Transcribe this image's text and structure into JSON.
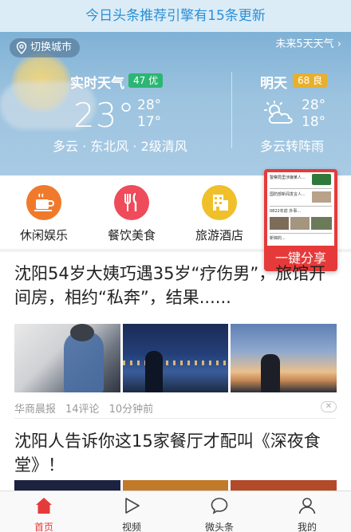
{
  "banner": {
    "text": "今日头条推荐引擎有15条更新"
  },
  "weather": {
    "city_button": "切换城市",
    "forecast_link": "未来5天天气 ›",
    "today": {
      "label": "实时天气",
      "aqi": "47 优",
      "temp": "23°",
      "high": "28°",
      "low": "17°",
      "desc": "多云 · 东北风 · 2级清风"
    },
    "tomorrow": {
      "label": "明天",
      "aqi": "68 良",
      "high": "28°",
      "low": "18°",
      "desc": "多云转阵雨"
    }
  },
  "categories": [
    {
      "label": "休闲娱乐",
      "icon": "coffee-icon",
      "color": "#f07a2b"
    },
    {
      "label": "餐饮美食",
      "icon": "dining-icon",
      "color": "#ee4b5b"
    },
    {
      "label": "旅游酒店",
      "icon": "hotel-icon",
      "color": "#f0c02a"
    }
  ],
  "share_popup": {
    "label": "一键分享",
    "preview_lines": [
      "警察局里涉嫌某人...",
      "国防部新闻发言人...",
      "0822年前 外事...",
      "新锦的..."
    ]
  },
  "articles": [
    {
      "title": "沈阳54岁大姨巧遇35岁“疗伤男”，旅馆开间房，相约“私奔”，结果......",
      "source": "华商晨报",
      "comments": "14评论",
      "time": "10分钟前"
    },
    {
      "title": "沈阳人告诉你这15家餐厅才配叫《深夜食堂》！"
    }
  ],
  "tabs": [
    {
      "label": "首页",
      "icon": "home-icon",
      "active": true
    },
    {
      "label": "视频",
      "icon": "play-icon",
      "active": false
    },
    {
      "label": "微头条",
      "icon": "chat-bubble-icon",
      "active": false
    },
    {
      "label": "我的",
      "icon": "person-icon",
      "active": false
    }
  ],
  "colors": {
    "accent": "#e63a3a",
    "banner_text": "#2a8fd6",
    "aqi_good": "#2bb673",
    "aqi_moderate": "#e7b02d"
  }
}
